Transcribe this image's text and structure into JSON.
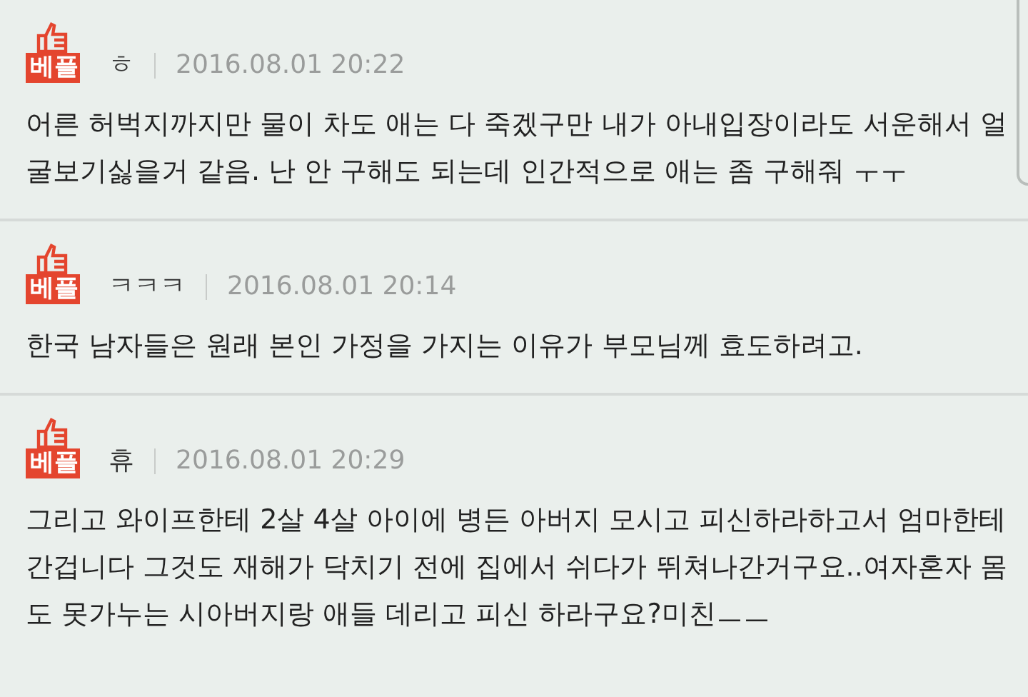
{
  "comments": [
    {
      "badge": "베플",
      "author": "ㅎ",
      "date": "2016.08.01 20:22",
      "text": "어른 허벅지까지만 물이 차도 애는 다 죽겠구만 내가 아내입장이라도 서운해서 얼굴보기싫을거 같음. 난 안 구해도 되는데 인간적으로 애는 좀 구해줘 ㅜㅜ"
    },
    {
      "badge": "베플",
      "author": "ㅋㅋㅋ",
      "date": "2016.08.01 20:14",
      "text": "한국 남자들은 원래 본인 가정을 가지는 이유가 부모님께 효도하려고."
    },
    {
      "badge": "베플",
      "author": "휴",
      "date": "2016.08.01 20:29",
      "text": "그리고 와이프한테 2살 4살 아이에 병든 아버지 모시고 피신하라하고서 엄마한테 간겁니다 그것도 재해가 닥치기 전에 집에서 쉬다가 뛰쳐나간거구요..여자혼자 몸도 못가누는 시아버지랑 애들 데리고 피신 하라구요?미친ㅡㅡ"
    }
  ]
}
